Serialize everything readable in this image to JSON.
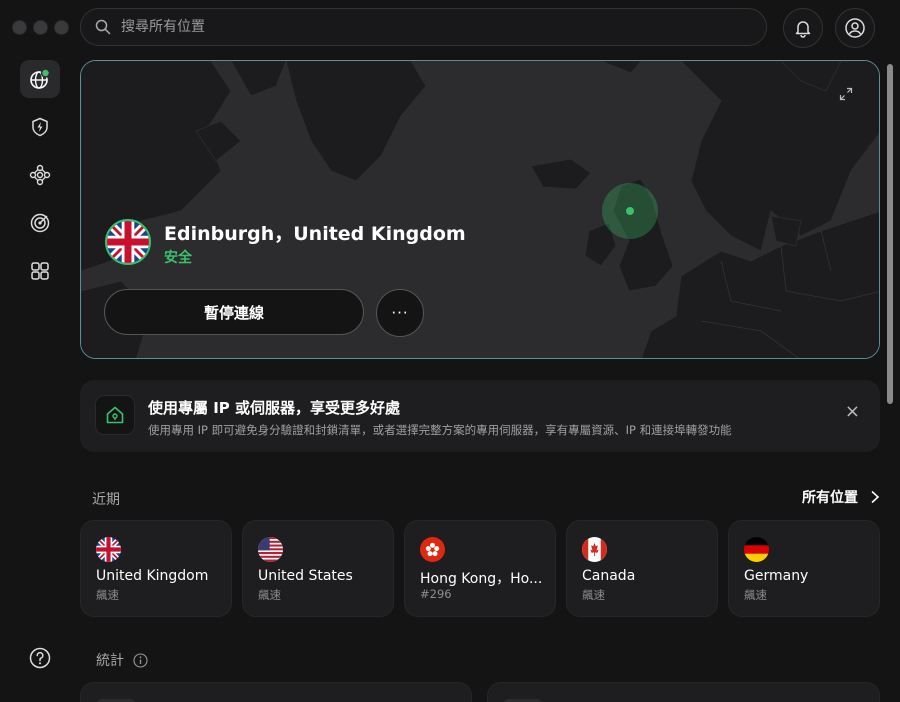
{
  "search": {
    "placeholder": "搜尋所有位置"
  },
  "connection": {
    "location": "Edinburgh，United Kingdom",
    "status": "安全",
    "pause_label": "暫停連線",
    "more_label": "···"
  },
  "banner": {
    "title": "使用專屬 IP 或伺服器，享受更多好處",
    "description": "使用專用 IP 即可避免身分驗證和封鎖清單，或者選擇完整方案的專用伺服器，享有專屬資源、IP 和連接埠轉發功能",
    "close": "×"
  },
  "recent": {
    "label": "近期",
    "all_locations": "所有位置",
    "items": [
      {
        "name": "United Kingdom",
        "sub": "飆速",
        "flag": "uk-flag"
      },
      {
        "name": "United States",
        "sub": "飆速",
        "flag": "us-flag"
      },
      {
        "name": "Hong Kong，Ho...",
        "sub": "#296",
        "flag": "hk-flag"
      },
      {
        "name": "Canada",
        "sub": "飆速",
        "flag": "ca-flag"
      },
      {
        "name": "Germany",
        "sub": "飆速",
        "flag": "de-flag"
      }
    ]
  },
  "stats": {
    "label": "統計"
  },
  "colors": {
    "accent_green": "#3ac26a",
    "map_border": "#5a8f98"
  }
}
